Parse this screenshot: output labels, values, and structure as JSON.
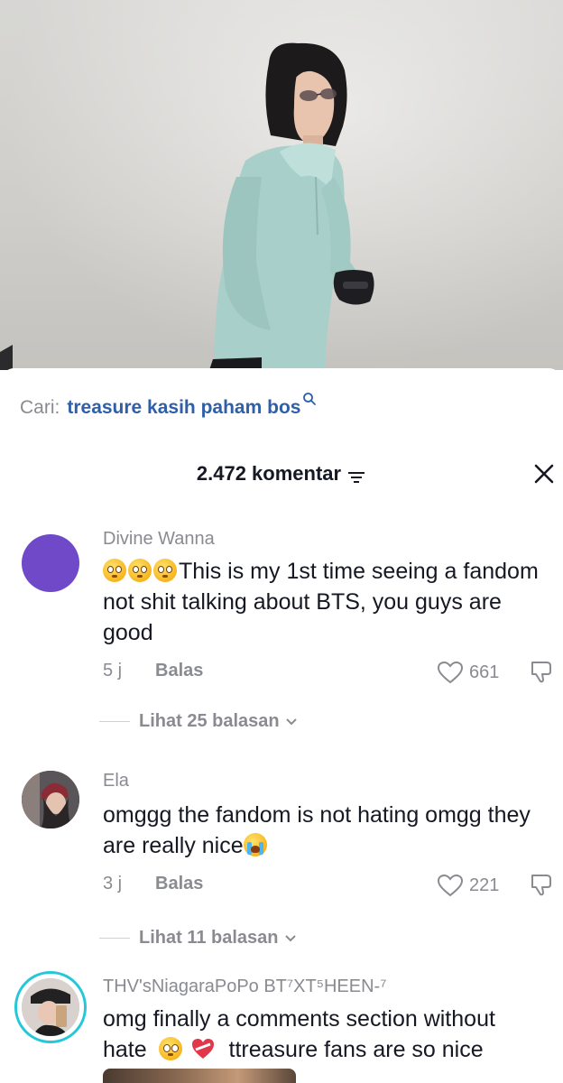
{
  "search": {
    "prefix": "Cari:",
    "query": "treasure kasih paham bos"
  },
  "header": {
    "title": "2.472 komentar"
  },
  "colors": {
    "accent_link": "#2f5fa8",
    "muted_text": "#8a8b91",
    "primary_text": "#161823",
    "avatar_purple": "#6f49c8",
    "ring_teal": "#25c7d9"
  },
  "comments": [
    {
      "author": "Divine Wanna",
      "text": "This is my 1st time seeing a fandom not shit talking about BTS, you guys are good",
      "time": "5 j",
      "reply_label": "Balas",
      "likes": "661",
      "replies_label": "Lihat 25 balasan"
    },
    {
      "author": "Ela",
      "text": "omggg the fandom is not hating omgg they are really nice",
      "time": "3 j",
      "reply_label": "Balas",
      "likes": "221",
      "replies_label": "Lihat 11 balasan"
    },
    {
      "author": "THV'sNiagaraPoPo BT⁷XT⁵HEEN-⁷",
      "text_line1": "omg finally a comments section without",
      "text_line2a": "hate",
      "text_line2b": "ttreasure fans are so nice"
    }
  ]
}
